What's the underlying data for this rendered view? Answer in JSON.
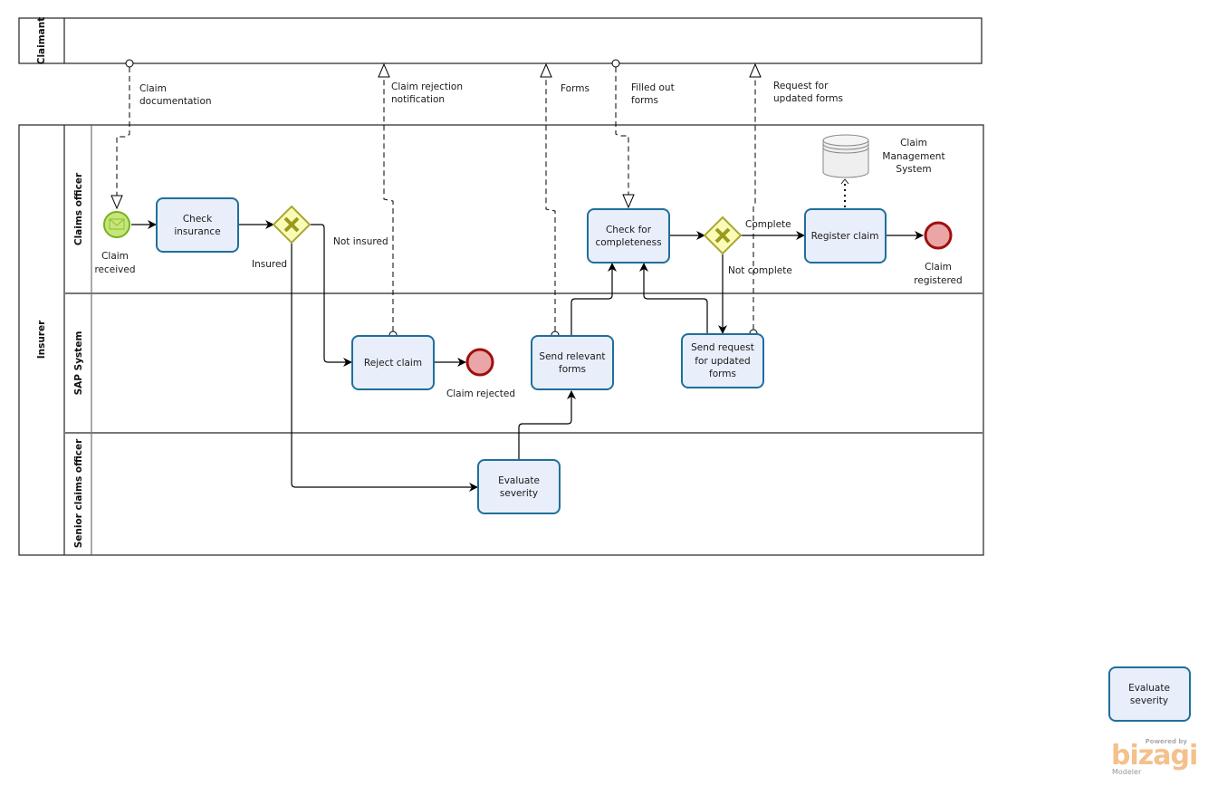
{
  "pools": {
    "claimant": {
      "label": "Claimant"
    },
    "insurer": {
      "label": "Insurer",
      "lanes": [
        {
          "label": "Claims officer"
        },
        {
          "label": "SAP System"
        },
        {
          "label": "Senior claims officer"
        }
      ]
    }
  },
  "events": {
    "start": {
      "label_line1": "Claim",
      "label_line2": "received",
      "type": "message-start",
      "icon": "envelope-icon"
    },
    "end_rejected": {
      "label": "Claim rejected",
      "type": "end"
    },
    "end_registered": {
      "label_line1": "Claim",
      "label_line2": "registered",
      "type": "end"
    }
  },
  "tasks": {
    "check_insurance": {
      "line1": "Check",
      "line2": "insurance"
    },
    "reject_claim": {
      "line1": "Reject claim"
    },
    "evaluate_severity": {
      "line1": "Evaluate",
      "line2": "severity"
    },
    "send_forms": {
      "line1": "Send relevant",
      "line2": "forms"
    },
    "check_completeness": {
      "line1": "Check for",
      "line2": "completeness"
    },
    "send_request": {
      "line1": "Send request",
      "line2": "for updated",
      "line3": "forms"
    },
    "register_claim": {
      "line1": "Register claim"
    }
  },
  "gateways": {
    "insured": {
      "type": "exclusive",
      "out_yes": "Insured",
      "out_no": "Not insured"
    },
    "complete": {
      "type": "exclusive",
      "out_yes": "Complete",
      "out_no": "Not complete"
    }
  },
  "data_store": {
    "line1": "Claim",
    "line2": "Management",
    "line3": "System"
  },
  "message_flows": [
    {
      "line1": "Claim",
      "line2": "documentation"
    },
    {
      "line1": "Claim rejection",
      "line2": "notification"
    },
    {
      "line1": "Forms"
    },
    {
      "line1": "Filled out",
      "line2": "forms"
    },
    {
      "line1": "Request for",
      "line2": "updated forms"
    }
  ],
  "palette_preview": {
    "line1": "Evaluate",
    "line2": "severity"
  },
  "watermark": {
    "powered": "Powered by",
    "brand": "bizagi",
    "product": "Modeler"
  },
  "colors": {
    "task_fill": "#e9eefb",
    "task_stroke": "#1f6f9a",
    "start_fill": "#c5e67a",
    "start_stroke": "#7ab01c",
    "end_fill": "#eaa6a6",
    "end_stroke": "#a00f0f",
    "gateway_fill": "#fbfbb8",
    "gateway_stroke": "#a8a834",
    "gateway_mark": "#9a9a1c"
  }
}
